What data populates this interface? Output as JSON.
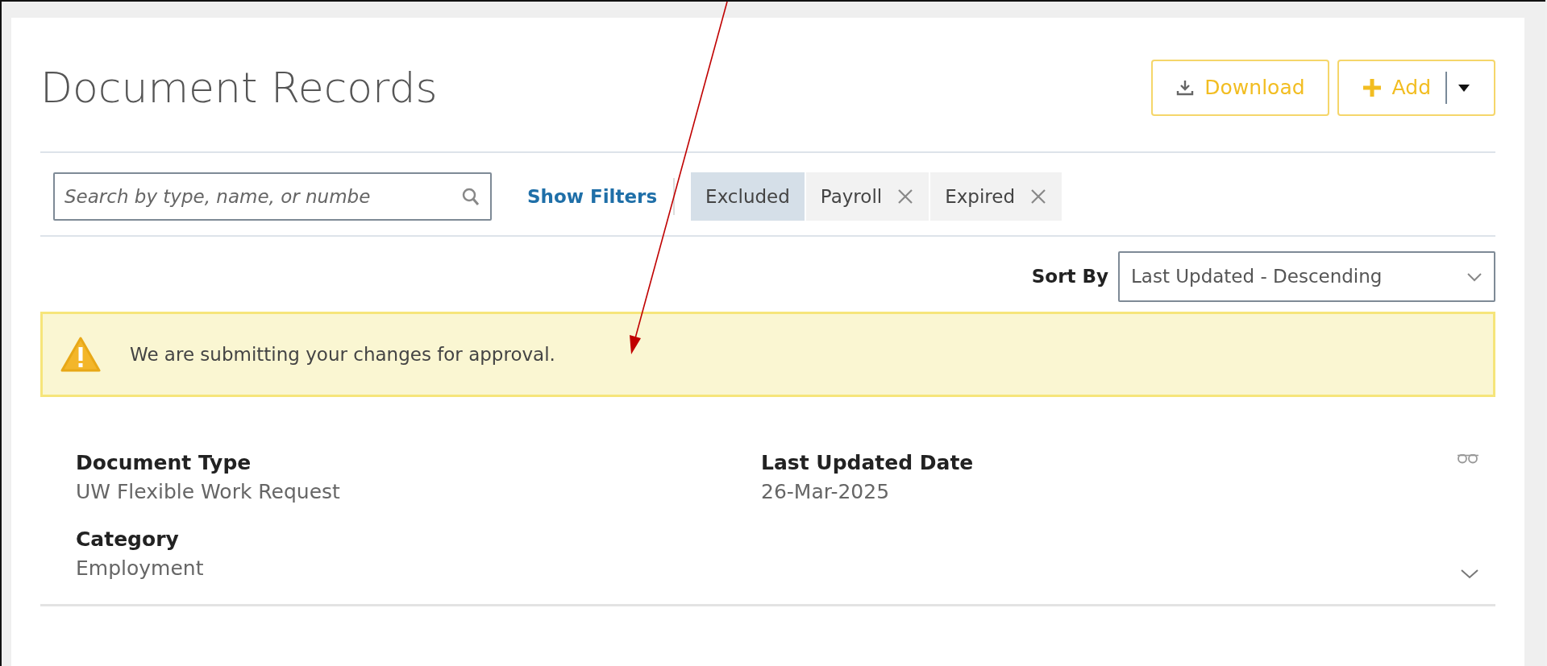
{
  "page": {
    "title": "Document Records"
  },
  "actions": [
    {
      "kind": "download",
      "label": "Download"
    },
    {
      "kind": "add",
      "label": "Add",
      "has_menu": true
    }
  ],
  "search": {
    "placeholder": "Search by type, name, or numbe"
  },
  "filters_link": "Show Filters",
  "chips": [
    {
      "label": "Excluded",
      "selected": true,
      "removable": false
    },
    {
      "label": "Payroll",
      "selected": false,
      "removable": true
    },
    {
      "label": "Expired",
      "selected": false,
      "removable": true
    }
  ],
  "sort": {
    "label": "Sort By",
    "value": "Last Updated - Descending"
  },
  "alert": {
    "kind": "warning",
    "message": "We are submitting your changes for approval."
  },
  "records": [
    {
      "fields": [
        {
          "label": "Document Type",
          "value": "UW Flexible Work Request"
        },
        {
          "label": "Last Updated Date",
          "value": "26-Mar-2025"
        },
        {
          "label": "Category",
          "value": "Employment"
        }
      ],
      "expanded": false
    }
  ],
  "annotation": {
    "kind": "arrow"
  }
}
